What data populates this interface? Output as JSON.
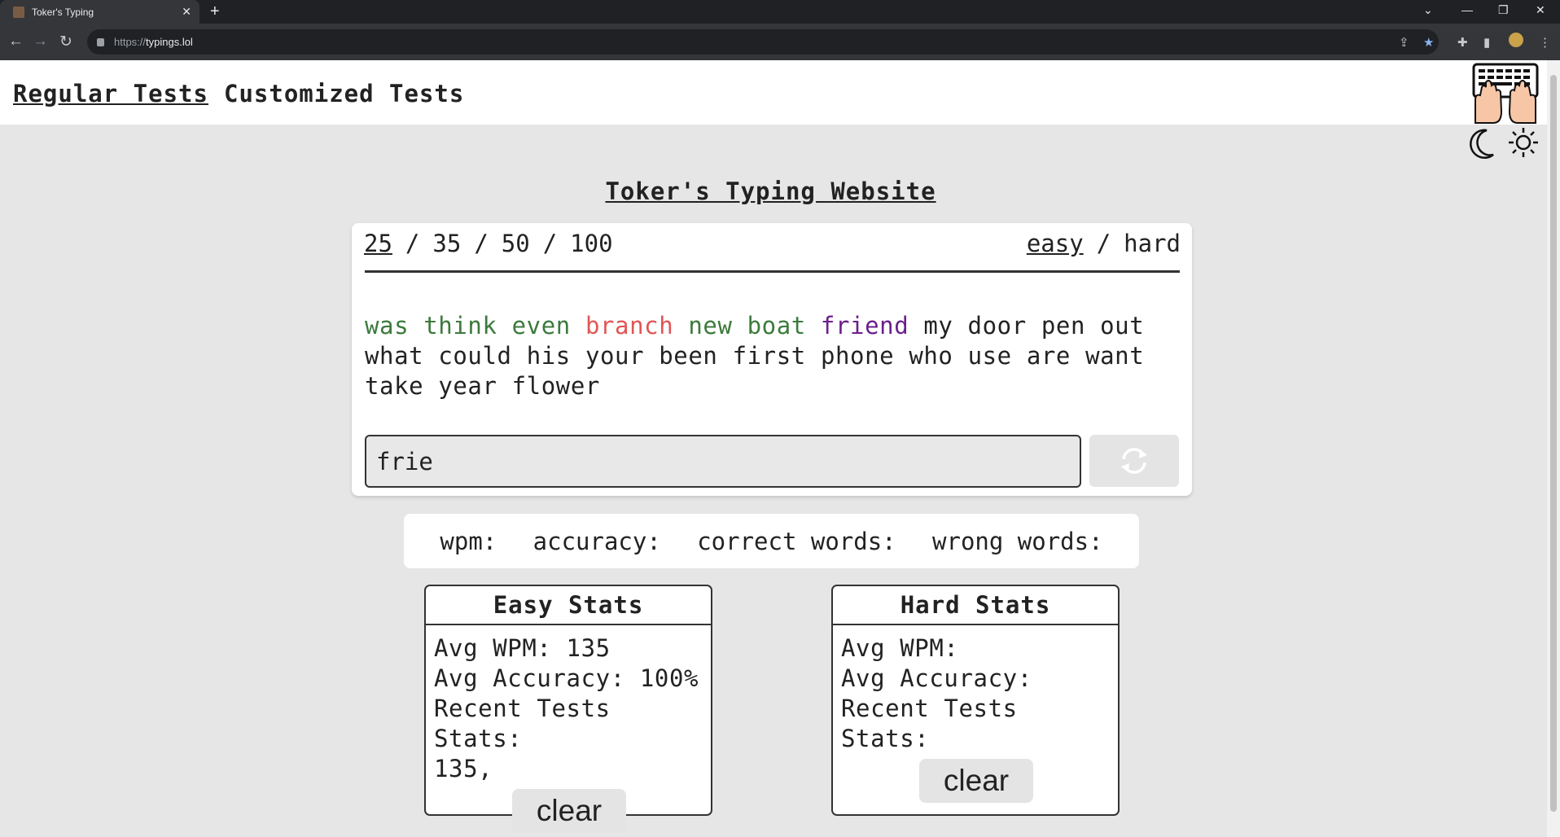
{
  "browser": {
    "tab_title": "Toker's Typing",
    "new_tab": "+",
    "url_scheme": "https://",
    "url_host": "typings.lol"
  },
  "nav": {
    "regular": "Regular Tests",
    "customized": "Customized Tests"
  },
  "title": "Toker's Typing Website",
  "word_counts": [
    "25",
    "35",
    "50",
    "100"
  ],
  "selected_word_count": "25",
  "difficulty": [
    "easy",
    "hard"
  ],
  "selected_difficulty": "easy",
  "separator": "/",
  "words": [
    {
      "text": "was",
      "state": "correct"
    },
    {
      "text": "think",
      "state": "correct"
    },
    {
      "text": "even",
      "state": "correct"
    },
    {
      "text": "branch",
      "state": "wrong"
    },
    {
      "text": "new",
      "state": "correct"
    },
    {
      "text": "boat",
      "state": "correct"
    },
    {
      "text": "friend",
      "state": "current"
    },
    {
      "text": "my",
      "state": "pending"
    },
    {
      "text": "door",
      "state": "pending"
    },
    {
      "text": "pen",
      "state": "pending"
    },
    {
      "text": "out",
      "state": "pending"
    },
    {
      "text": "what",
      "state": "pending"
    },
    {
      "text": "could",
      "state": "pending"
    },
    {
      "text": "his",
      "state": "pending"
    },
    {
      "text": "your",
      "state": "pending"
    },
    {
      "text": "been",
      "state": "pending"
    },
    {
      "text": "first",
      "state": "pending"
    },
    {
      "text": "phone",
      "state": "pending"
    },
    {
      "text": "who",
      "state": "pending"
    },
    {
      "text": "use",
      "state": "pending"
    },
    {
      "text": "are",
      "state": "pending"
    },
    {
      "text": "want",
      "state": "pending"
    },
    {
      "text": "take",
      "state": "pending"
    },
    {
      "text": "year",
      "state": "pending"
    },
    {
      "text": "flower",
      "state": "pending"
    }
  ],
  "input_value": "frie",
  "stats": {
    "wpm": "wpm:",
    "accuracy": "accuracy:",
    "correct": "correct words:",
    "wrong": "wrong words:"
  },
  "easy_stats": {
    "title": "Easy Stats",
    "avg_wpm_label": "Avg WPM: 135",
    "avg_acc_label": "Avg Accuracy: 100%",
    "recent_label": "Recent Tests Stats:",
    "recent_values": "135,",
    "clear": "clear"
  },
  "hard_stats": {
    "title": "Hard Stats",
    "avg_wpm_label": "Avg WPM:",
    "avg_acc_label": "Avg Accuracy:",
    "recent_label": "Recent Tests Stats:",
    "clear": "clear"
  },
  "colors": {
    "correct": "#3c7a3c",
    "wrong": "#e05656",
    "current": "#6b1f8c",
    "pending": "#222222"
  },
  "icons": [
    "refresh-icon",
    "moon-icon",
    "sun-icon",
    "typing-hands-logo"
  ]
}
